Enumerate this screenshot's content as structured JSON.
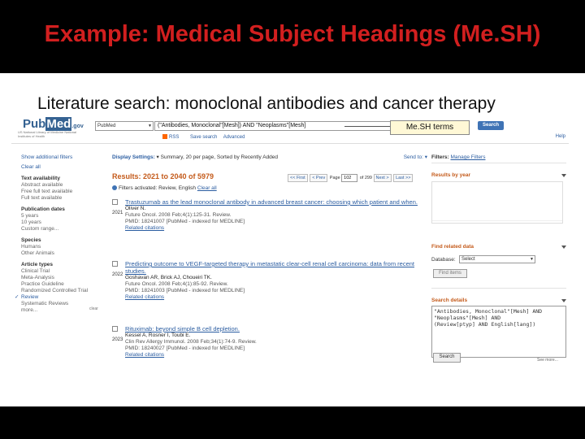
{
  "slide": {
    "title": "Example: Medical Subject Headings (Me.SH)",
    "subtitle": "Literature search: monoclonal antibodies and cancer therapy",
    "callout": "Me.SH terms"
  },
  "pubmed": {
    "logo_pub": "Pub",
    "logo_med": "Med",
    "logo_gov": ".gov",
    "logo_sub": "US National Library of Medicine National Institutes of Health",
    "db_select": "PubMed",
    "query": "(\"Antibodies, Monoclonal\"[Mesh]) AND \"Neoplasms\"[Mesh]",
    "search_label": "Search",
    "links": [
      "RSS",
      "Save search",
      "Advanced"
    ],
    "help": "Help"
  },
  "left": {
    "show_filters": "Show additional filters",
    "clear_all": "Clear all",
    "text_avail_hd": "Text availability",
    "text_avail": [
      "Abstract available",
      "Free full text available",
      "Full text available"
    ],
    "pub_dates_hd": "Publication dates",
    "pub_dates": [
      "5 years",
      "10 years",
      "Custom range..."
    ],
    "species_hd": "Species",
    "species": [
      "Humans",
      "Other Animals"
    ],
    "article_hd": "Article types",
    "article_clear": "clear",
    "article_types": [
      "Clinical Trial",
      "Meta-Analysis",
      "Practice Guideline",
      "Randomized Controlled Trial",
      "Review",
      "Systematic Reviews",
      "more..."
    ],
    "checked_index": 4
  },
  "mid": {
    "display_label": "Display Settings:",
    "display_value": "Summary, 20 per page, Sorted by Recently Added",
    "send_to": "Send to:",
    "results": "Results: 2021 to 2040 of 5979",
    "pager": {
      "first": "<< First",
      "prev": "< Prev",
      "page_label": "Page",
      "page": "102",
      "of": "of 299",
      "next": "Next >",
      "last": "Last >>"
    },
    "filters": "Filters activated: Review, English",
    "filters_clear": "Clear all",
    "items": [
      {
        "num": "2021",
        "title": "Trastuzumab as the lead monoclonal antibody in advanced breast cancer: choosing which patient and when.",
        "authors": "Oliver N.",
        "journal": "Future Oncol. 2008 Feb;4(1):125-31. Review.",
        "pmid": "PMID: 18241007 [PubMed - indexed for MEDLINE]",
        "related": "Related citations"
      },
      {
        "num": "2022",
        "title": "Predicting outcome to VEGF-targeted therapy in metastatic clear-cell renal cell carcinoma: data from recent studies.",
        "authors": "Goshavan AR, Brick AJ, Choueiri TK.",
        "journal": "Future Oncol. 2008 Feb;4(1):85-92. Review.",
        "pmid": "PMID: 18241003 [PubMed - indexed for MEDLINE]",
        "related": "Related citations"
      },
      {
        "num": "2023",
        "title": "Rituximab: beyond simple B cell depletion.",
        "authors": "Kessel A, Rosner I, Toubi E.",
        "journal": "Clin Rev Allergy Immunol. 2008 Feb;34(1):74-9. Review.",
        "pmid": "PMID: 18240027 [PubMed - indexed for MEDLINE]",
        "related": "Related citations"
      }
    ]
  },
  "right": {
    "filters_hd": "Filters:",
    "manage": "Manage Filters",
    "results_year": "Results by year",
    "find_related": "Find related data",
    "database_label": "Database:",
    "database_value": "Select",
    "find_items": "Find items",
    "search_details": "Search details",
    "details_query": "\"Antibodies, Monoclonal\"[Mesh] AND\n\"Neoplasms\"[Mesh] AND\n(Review[ptyp] AND English[lang])",
    "search_btn": "Search",
    "see_more": "See more..."
  }
}
